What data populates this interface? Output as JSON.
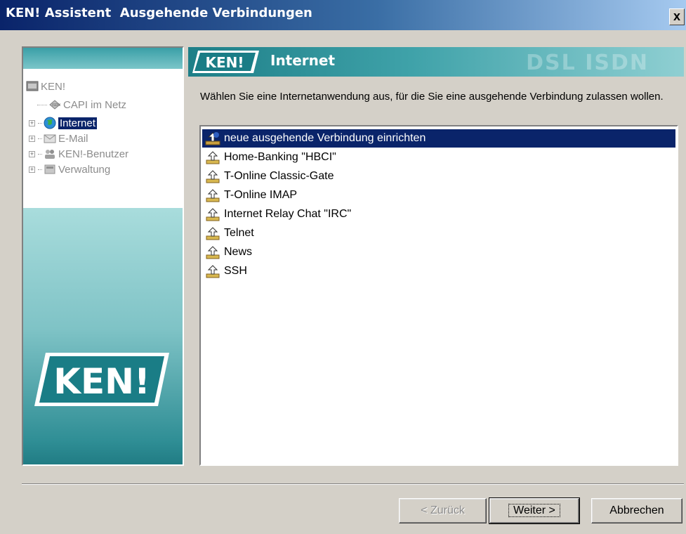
{
  "window": {
    "title": "KEN! Assistent  Ausgehende Verbindungen",
    "close_label": "x"
  },
  "banner": {
    "logo_text": "KEN!",
    "title": "Internet",
    "watermark": "DSL  ISDN"
  },
  "tree": {
    "items": [
      {
        "label": "KEN!",
        "icon": "ken-root-icon"
      },
      {
        "label": "CAPI im Netz",
        "icon": "capi-icon"
      },
      {
        "label": "Internet",
        "icon": "globe-icon",
        "selected": true
      },
      {
        "label": "E-Mail",
        "icon": "mail-icon"
      },
      {
        "label": "KEN!-Benutzer",
        "icon": "users-icon"
      },
      {
        "label": "Verwaltung",
        "icon": "admin-icon"
      }
    ]
  },
  "side_logo_text": "KEN!",
  "description": "Wählen Sie eine Internetanwendung aus, für die Sie eine ausgehende Verbindung zulassen wollen.",
  "list": {
    "items": [
      {
        "label": "neue ausgehende Verbindung einrichten",
        "selected": true
      },
      {
        "label": "Home-Banking \"HBCI\""
      },
      {
        "label": "T-Online Classic-Gate"
      },
      {
        "label": "T-Online IMAP"
      },
      {
        "label": "Internet Relay Chat \"IRC\""
      },
      {
        "label": "Telnet"
      },
      {
        "label": "News"
      },
      {
        "label": "SSH"
      }
    ]
  },
  "buttons": {
    "back": "< Zurück",
    "next": "Weiter >",
    "cancel": "Abbrechen"
  }
}
